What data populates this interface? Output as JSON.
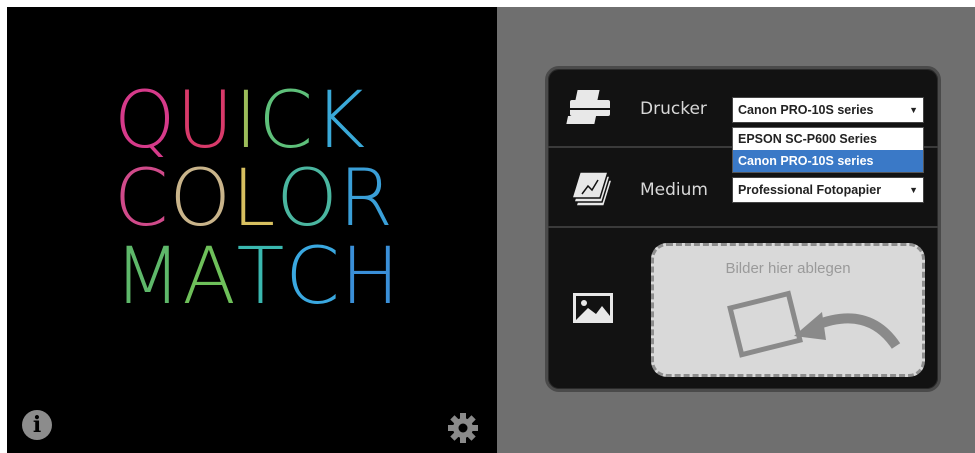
{
  "app": {
    "logo_lines": [
      [
        {
          "ch": "Q",
          "color": "#d63a8a"
        },
        {
          "ch": "U",
          "color": "#d83a6a"
        },
        {
          "ch": "I",
          "color": "#9cbc5a"
        },
        {
          "ch": "C",
          "color": "#5ec07a"
        },
        {
          "ch": "K",
          "color": "#3aa9d8"
        }
      ],
      [
        {
          "ch": "C",
          "color": "#d04a8a"
        },
        {
          "ch": "O",
          "color": "#c9b48a"
        },
        {
          "ch": "L",
          "color": "#d8c060"
        },
        {
          "ch": "O",
          "color": "#4ab6a0"
        },
        {
          "ch": "R",
          "color": "#3a9fd8"
        }
      ],
      [
        {
          "ch": "M",
          "color": "#5eb86a"
        },
        {
          "ch": "A",
          "color": "#6ec05a"
        },
        {
          "ch": "T",
          "color": "#3ab8b0"
        },
        {
          "ch": "C",
          "color": "#3aa8e0"
        },
        {
          "ch": "H",
          "color": "#3a8fd8"
        }
      ]
    ]
  },
  "footer": {
    "info_symbol": "i",
    "info_icon_name": "info-icon",
    "settings_icon_name": "gear-icon"
  },
  "printer": {
    "label": "Drucker",
    "selected": "Canon PRO-10S series",
    "options": [
      "EPSON SC-P600 Series",
      "Canon PRO-10S series"
    ],
    "highlighted_option": "Canon PRO-10S series",
    "icon_name": "printer-icon"
  },
  "medium": {
    "label": "Medium",
    "selected": "Professional Fotopapier",
    "icon_name": "paper-stack-icon"
  },
  "dropzone": {
    "text": "Bilder hier ablegen",
    "icon_name": "image-icon"
  },
  "dropdown_arrow": "▼",
  "colors": {
    "left_bg": "#000000",
    "right_bg": "#6f6f6f",
    "selection": "#3a79c7"
  }
}
